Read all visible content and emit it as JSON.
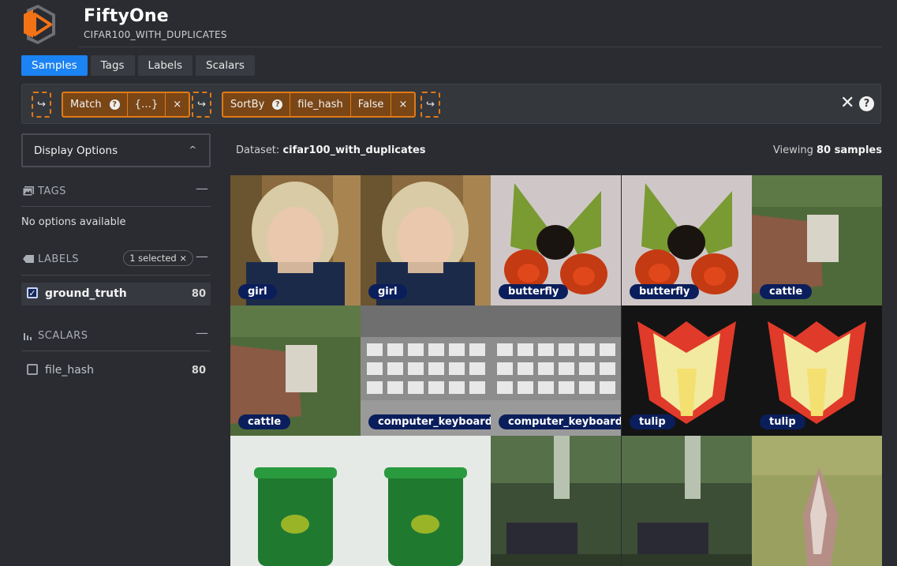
{
  "app": {
    "title": "FiftyOne",
    "dataset_header": "CIFAR100_WITH_DUPLICATES"
  },
  "tabs": [
    {
      "label": "Samples",
      "active": true
    },
    {
      "label": "Tags",
      "active": false
    },
    {
      "label": "Labels",
      "active": false
    },
    {
      "label": "Scalars",
      "active": false
    }
  ],
  "view_bar": {
    "add_stage_glyph": "↪",
    "stages": [
      {
        "name": "Match",
        "help": "?",
        "params": [
          "{…}"
        ],
        "remove": "×"
      },
      {
        "name": "SortBy",
        "help": "?",
        "params": [
          "file_hash",
          "False"
        ],
        "remove": "×"
      }
    ],
    "clear_glyph": "✕",
    "help_glyph": "?"
  },
  "sidebar": {
    "display_options": {
      "label": "Display Options",
      "chevron": "^"
    },
    "tags": {
      "title": "TAGS",
      "collapse": "—",
      "empty": "No options available"
    },
    "labels": {
      "title": "LABELS",
      "selected": "1 selected ×",
      "collapse": "—",
      "fields": [
        {
          "name": "ground_truth",
          "count": "80",
          "checked": true
        }
      ]
    },
    "scalars": {
      "title": "SCALARS",
      "collapse": "—",
      "fields": [
        {
          "name": "file_hash",
          "count": "80",
          "checked": false
        }
      ]
    }
  },
  "main": {
    "dataset_prefix": "Dataset:",
    "dataset_name": "cifar100_with_duplicates",
    "viewing_prefix": "Viewing",
    "viewing_count": "80 samples"
  },
  "samples": [
    {
      "label": "girl",
      "thumb": "girl"
    },
    {
      "label": "girl",
      "thumb": "girl"
    },
    {
      "label": "butterfly",
      "thumb": "butterfly"
    },
    {
      "label": "butterfly",
      "thumb": "butterfly"
    },
    {
      "label": "cattle",
      "thumb": "cattle"
    },
    {
      "label": "cattle",
      "thumb": "cattle"
    },
    {
      "label": "computer_keyboard",
      "thumb": "keyboard"
    },
    {
      "label": "computer_keyboard",
      "thumb": "keyboard"
    },
    {
      "label": "tulip",
      "thumb": "tulip"
    },
    {
      "label": "tulip",
      "thumb": "tulip"
    },
    {
      "label": "",
      "thumb": "bin"
    },
    {
      "label": "",
      "thumb": "bin"
    },
    {
      "label": "",
      "thumb": "forest"
    },
    {
      "label": "",
      "thumb": "forest"
    },
    {
      "label": "",
      "thumb": "moth"
    }
  ],
  "colors": {
    "accent": "#1b83f3",
    "stage_border": "#e07a16",
    "stage_fill": "#7a4616",
    "label_badge": "#0b1e5c"
  }
}
